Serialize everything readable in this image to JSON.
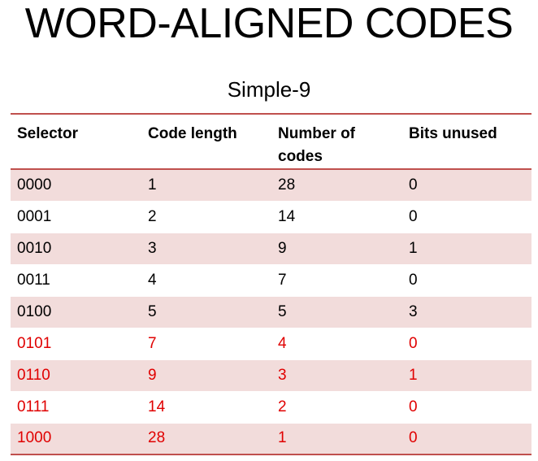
{
  "title": "WORD-ALIGNED CODES",
  "caption": "Simple-9",
  "colors": {
    "header_rule": "#c0504d",
    "shaded_row": "#f2dcdb",
    "normal_text": "#000000",
    "highlight_text": "#e00000"
  },
  "table": {
    "headers": {
      "selector": "Selector",
      "code_length": "Code length",
      "number_of_codes": "Number of codes",
      "bits_unused": "Bits unused"
    },
    "rows": [
      {
        "selector": "0000",
        "code_length": "1",
        "number_of_codes": "28",
        "bits_unused": "0",
        "highlight": false
      },
      {
        "selector": "0001",
        "code_length": "2",
        "number_of_codes": "14",
        "bits_unused": "0",
        "highlight": false
      },
      {
        "selector": "0010",
        "code_length": "3",
        "number_of_codes": "9",
        "bits_unused": "1",
        "highlight": false
      },
      {
        "selector": "0011",
        "code_length": "4",
        "number_of_codes": "7",
        "bits_unused": "0",
        "highlight": false
      },
      {
        "selector": "0100",
        "code_length": "5",
        "number_of_codes": "5",
        "bits_unused": "3",
        "highlight": false
      },
      {
        "selector": "0101",
        "code_length": "7",
        "number_of_codes": "4",
        "bits_unused": "0",
        "highlight": true
      },
      {
        "selector": "0110",
        "code_length": "9",
        "number_of_codes": "3",
        "bits_unused": "1",
        "highlight": true
      },
      {
        "selector": "0111",
        "code_length": "14",
        "number_of_codes": "2",
        "bits_unused": "0",
        "highlight": true
      },
      {
        "selector": "1000",
        "code_length": "28",
        "number_of_codes": "1",
        "bits_unused": "0",
        "highlight": true
      }
    ]
  }
}
